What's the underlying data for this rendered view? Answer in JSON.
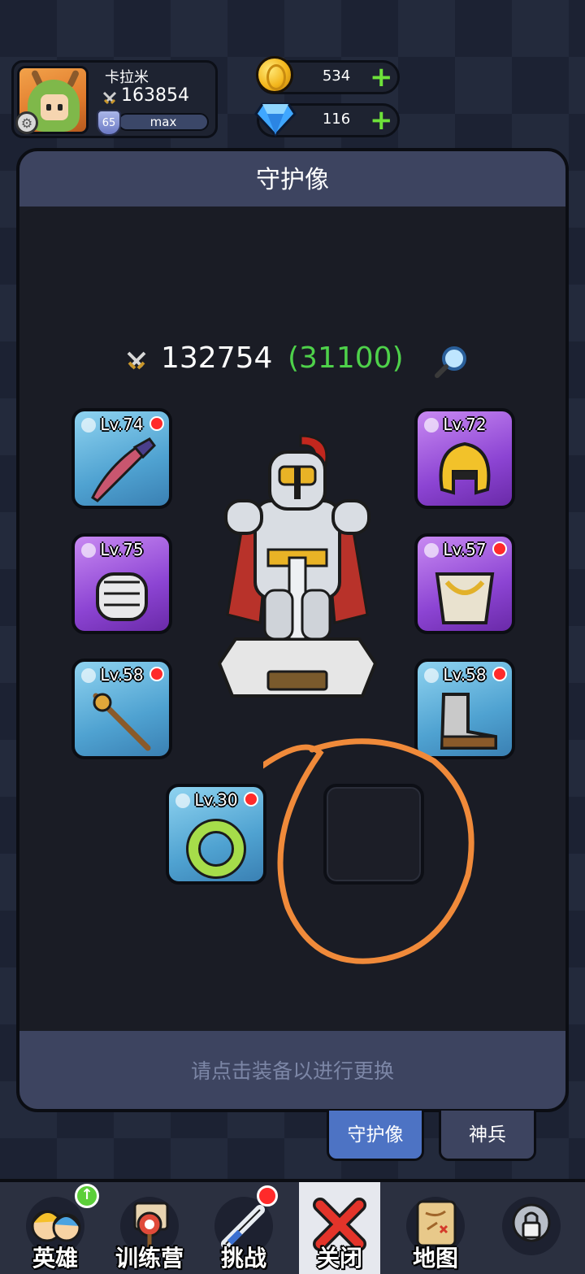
{
  "player": {
    "name": "卡拉米",
    "power": "163854",
    "level": "65",
    "exp_label": "max"
  },
  "resources": {
    "gold": "534",
    "gems": "116"
  },
  "panel": {
    "title": "守护像",
    "power_total": "132754",
    "power_bonus": "(31100)",
    "footer_hint": "请点击装备以进行更换"
  },
  "equipment": [
    {
      "slot": "weapon-top-left",
      "level": "Lv.74",
      "color": "blue",
      "has_alert": true,
      "icon": "dagger-icon"
    },
    {
      "slot": "helmet",
      "level": "Lv.72",
      "color": "purple",
      "has_alert": false,
      "icon": "helmet-icon"
    },
    {
      "slot": "gauntlet",
      "level": "Lv.75",
      "color": "purple",
      "has_alert": false,
      "icon": "gauntlet-icon"
    },
    {
      "slot": "armor",
      "level": "Lv.57",
      "color": "purple",
      "has_alert": true,
      "icon": "armor-icon"
    },
    {
      "slot": "staff",
      "level": "Lv.58",
      "color": "blue",
      "has_alert": true,
      "icon": "staff-icon"
    },
    {
      "slot": "boots",
      "level": "Lv.58",
      "color": "blue",
      "has_alert": true,
      "icon": "boots-icon"
    },
    {
      "slot": "ring",
      "level": "Lv.30",
      "color": "blue",
      "has_alert": true,
      "icon": "ring-icon"
    }
  ],
  "tabs": [
    {
      "label": "守护像",
      "active": true
    },
    {
      "label": "神兵",
      "active": false
    }
  ],
  "nav": [
    {
      "label": "英雄",
      "icon": "heroes-icon"
    },
    {
      "label": "训练营",
      "icon": "training-camp-icon"
    },
    {
      "label": "挑战",
      "icon": "challenge-icon"
    },
    {
      "label": "关闭",
      "icon": "close-icon"
    },
    {
      "label": "地图",
      "icon": "map-icon"
    },
    {
      "label": "",
      "icon": "locked-icon"
    }
  ],
  "colors": {
    "accent_green": "#4ed14a",
    "alert_red": "#ff2a2a",
    "panel_header": "#3d4460",
    "annotation_orange": "#f08a3a"
  }
}
